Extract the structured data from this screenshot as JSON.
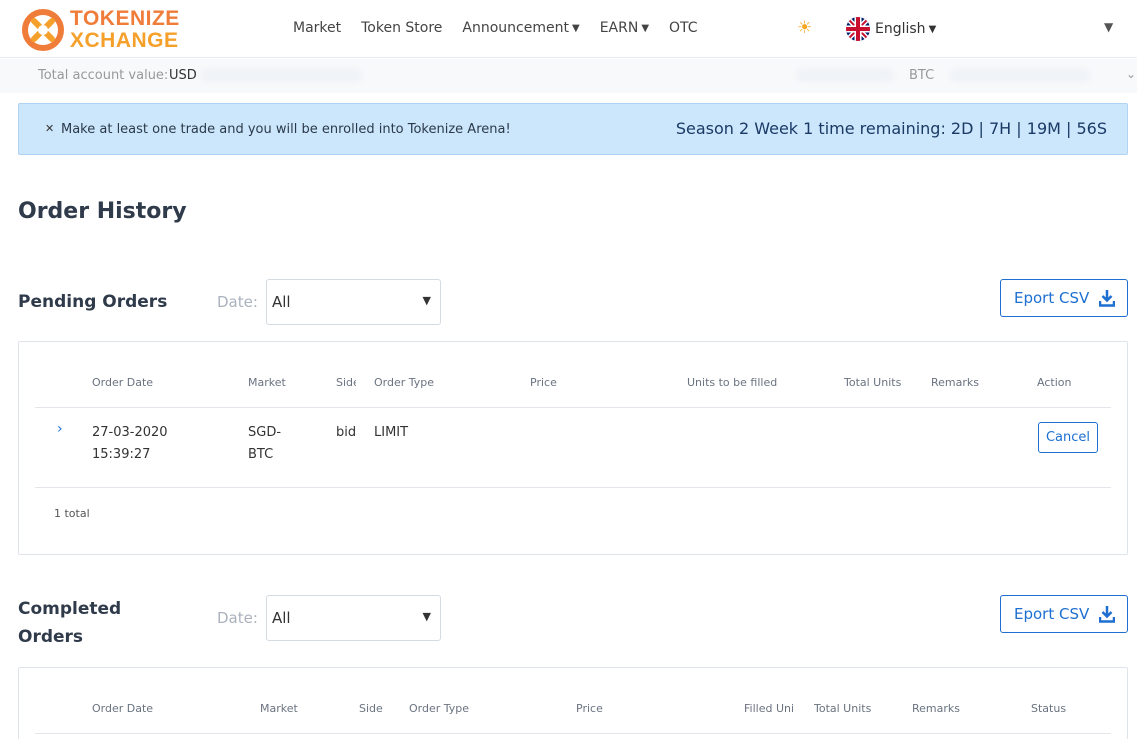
{
  "brand": {
    "name_line1": "TOKENIZE",
    "name_line2": "XCHANGE",
    "primary_color": "#f07c3a",
    "secondary_color": "#f5a02a"
  },
  "nav": {
    "items": [
      {
        "label": "Market",
        "has_dropdown": false
      },
      {
        "label": "Token Store",
        "has_dropdown": false
      },
      {
        "label": "Announcement",
        "has_dropdown": true
      },
      {
        "label": "EARN",
        "has_dropdown": true
      },
      {
        "label": "OTC",
        "has_dropdown": false
      }
    ],
    "theme_icon": "sun-icon",
    "language": "English",
    "language_flag": "uk-flag-icon"
  },
  "account": {
    "label": "Total account value:",
    "usd_label": "USD",
    "btc_label": "BTC"
  },
  "banner": {
    "close_icon": "close-icon",
    "message": "Make at least one trade and you will be enrolled into Tokenize Arena!",
    "timer": "Season 2 Week 1 time remaining: 2D | 7H | 19M | 56S",
    "background": "#cce6fb"
  },
  "page": {
    "title": "Order History"
  },
  "pending": {
    "title": "Pending Orders",
    "date_label": "Date:",
    "date_value": "All",
    "export_label": "Eport CSV",
    "columns": [
      "Order Date",
      "Market",
      "Side",
      "Order Type",
      "Price",
      "Units to be filled",
      "Total Units",
      "Remarks",
      "Action"
    ],
    "rows": [
      {
        "date": "27-03-2020",
        "time": "15:39:27",
        "market_line1": "SGD-",
        "market_line2": "BTC",
        "side": "bid",
        "order_type": "LIMIT",
        "price": "",
        "units_to_fill": "",
        "total_units": "",
        "remarks": "",
        "action": "Cancel"
      }
    ],
    "total": "1 total"
  },
  "completed": {
    "title_line1": "Completed",
    "title_line2": "Orders",
    "date_label": "Date:",
    "date_value": "All",
    "export_label": "Eport CSV",
    "columns": [
      "Order Date",
      "Market",
      "Side",
      "Order Type",
      "Price",
      "Filled Units",
      "Total Units",
      "Remarks",
      "Status"
    ]
  },
  "accent_color": "#1d6fd1"
}
